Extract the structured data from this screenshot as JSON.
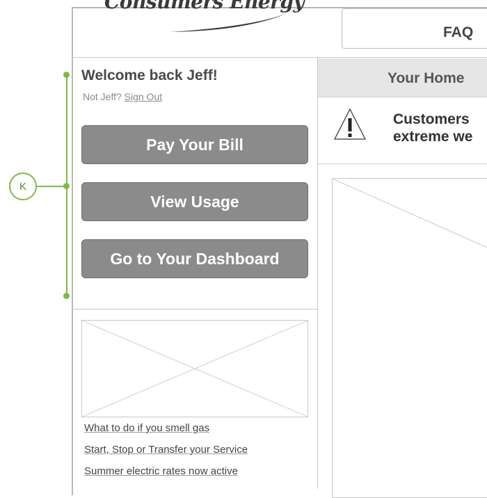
{
  "header": {
    "logo_text": "Consumers Energy",
    "faq_tab_label": "FAQ"
  },
  "sidebar": {
    "welcome_text": "Welcome back Jeff!",
    "not_user_text": "Not Jeff?",
    "sign_out_label": "Sign Out",
    "buttons": [
      {
        "label": "Pay Your Bill"
      },
      {
        "label": "View Usage"
      },
      {
        "label": "Go to Your Dashboard"
      }
    ],
    "links": [
      {
        "label": "What to do if you smell gas"
      },
      {
        "label": "Start, Stop or Transfer your Service"
      },
      {
        "label": "Summer electric rates now active"
      }
    ]
  },
  "main": {
    "section_title": "Your Home",
    "alert_line1": "Customers",
    "alert_line2": "extreme we"
  },
  "annotation": {
    "callout_letter": "K"
  },
  "colors": {
    "callout": "#7dbb43",
    "button_bg": "#8b8b8b",
    "button_text": "#ffffff"
  }
}
